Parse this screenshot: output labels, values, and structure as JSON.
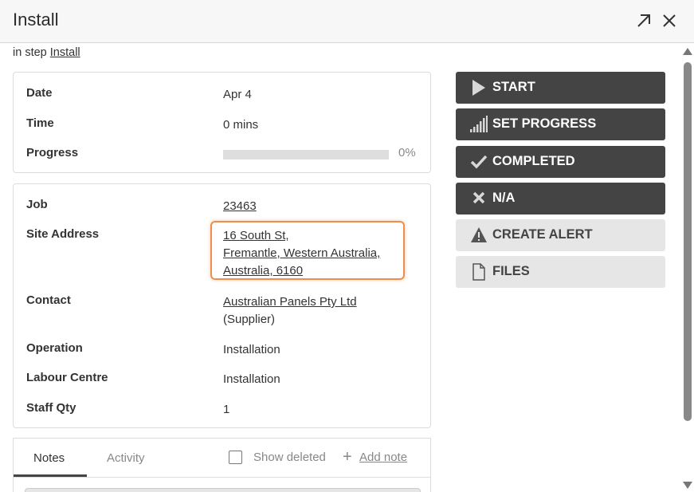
{
  "header": {
    "title": "Install"
  },
  "subline": {
    "prefix": "in step",
    "step_link": "Install"
  },
  "summary": {
    "date_label": "Date",
    "date_value": "Apr 4",
    "time_label": "Time",
    "time_value": "0 mins",
    "progress_label": "Progress",
    "progress_value": 0,
    "progress_text": "0%"
  },
  "details": {
    "job_label": "Job",
    "job_value": "23463",
    "site_label": "Site Address",
    "site_lines": [
      "16 South St,",
      "Fremantle, Western Australia,",
      "Australia, 6160"
    ],
    "contact_label": "Contact",
    "contact_name": "Australian Panels Pty Ltd",
    "contact_type": "(Supplier)",
    "operation_label": "Operation",
    "operation_value": "Installation",
    "labour_label": "Labour Centre",
    "labour_value": "Installation",
    "staff_label": "Staff Qty",
    "staff_value": "1"
  },
  "actions": [
    {
      "label": "START",
      "icon": "play-icon",
      "style": "dark"
    },
    {
      "label": "SET PROGRESS",
      "icon": "signal-bars-icon",
      "style": "dark"
    },
    {
      "label": "COMPLETED",
      "icon": "checkmark-icon",
      "style": "dark"
    },
    {
      "label": "N/A",
      "icon": "x-icon",
      "style": "dark"
    },
    {
      "label": "CREATE ALERT",
      "icon": "warning-icon",
      "style": "light"
    },
    {
      "label": "FILES",
      "icon": "file-icon",
      "style": "light"
    }
  ],
  "tabs": {
    "notes": "Notes",
    "activity": "Activity",
    "show_deleted": "Show deleted",
    "add_note": "Add note"
  },
  "colors": {
    "highlight": "#ef8d4c",
    "dark_button": "#444444",
    "light_button": "#e6e6e6"
  }
}
